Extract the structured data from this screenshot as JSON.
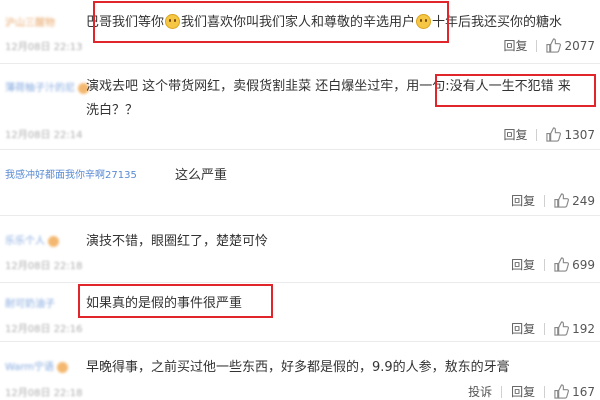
{
  "comments": [
    {
      "user": "沪山三醒物",
      "time": "12月08日 22:13",
      "text_parts": [
        "巴哥我们等你",
        "我们喜欢你叫我们家人和尊敬的辛选用户",
        "十年后我还买你的糖水"
      ],
      "reply_label": "回复",
      "likes": "2077"
    },
    {
      "user": "薄荷柚子汁的尼",
      "time": "12月08日 22:14",
      "text": "演戏去吧 这个带货网红，卖假货割韭菜 还白爆坐过牢，用一句:没有人一生不犯错 来洗白？？",
      "reply_label": "回复",
      "likes": "1307"
    },
    {
      "user": "我感冲好都面我你辛啊27135",
      "time": "",
      "text": "这么严重",
      "reply_label": "回复",
      "likes": "249"
    },
    {
      "user": "乐乐个人",
      "time": "12月08日 22:18",
      "text": "演技不错，眼圈红了，楚楚可怜",
      "reply_label": "回复",
      "likes": "699"
    },
    {
      "user": "耐可奶油子",
      "time": "12月08日 22:16",
      "text": "如果真的是假的事件很严重",
      "reply_label": "回复",
      "likes": "192"
    },
    {
      "user": "Warm宁语",
      "time": "12月08日 22:18",
      "text": "早晚得事，之前买过他一些东西，好多都是假的，9.9的人参，敖东的牙膏",
      "report_label": "投诉",
      "reply_label": "回复",
      "likes": "167"
    }
  ],
  "colors": {
    "highlight": "#e0262b",
    "emoji": "#f6c744",
    "username_orange": "#e08a3a",
    "username_blue": "#5b8bd4"
  },
  "icons": {
    "like": "thumbs-up-icon",
    "emoji": "sad-emoji-icon"
  }
}
